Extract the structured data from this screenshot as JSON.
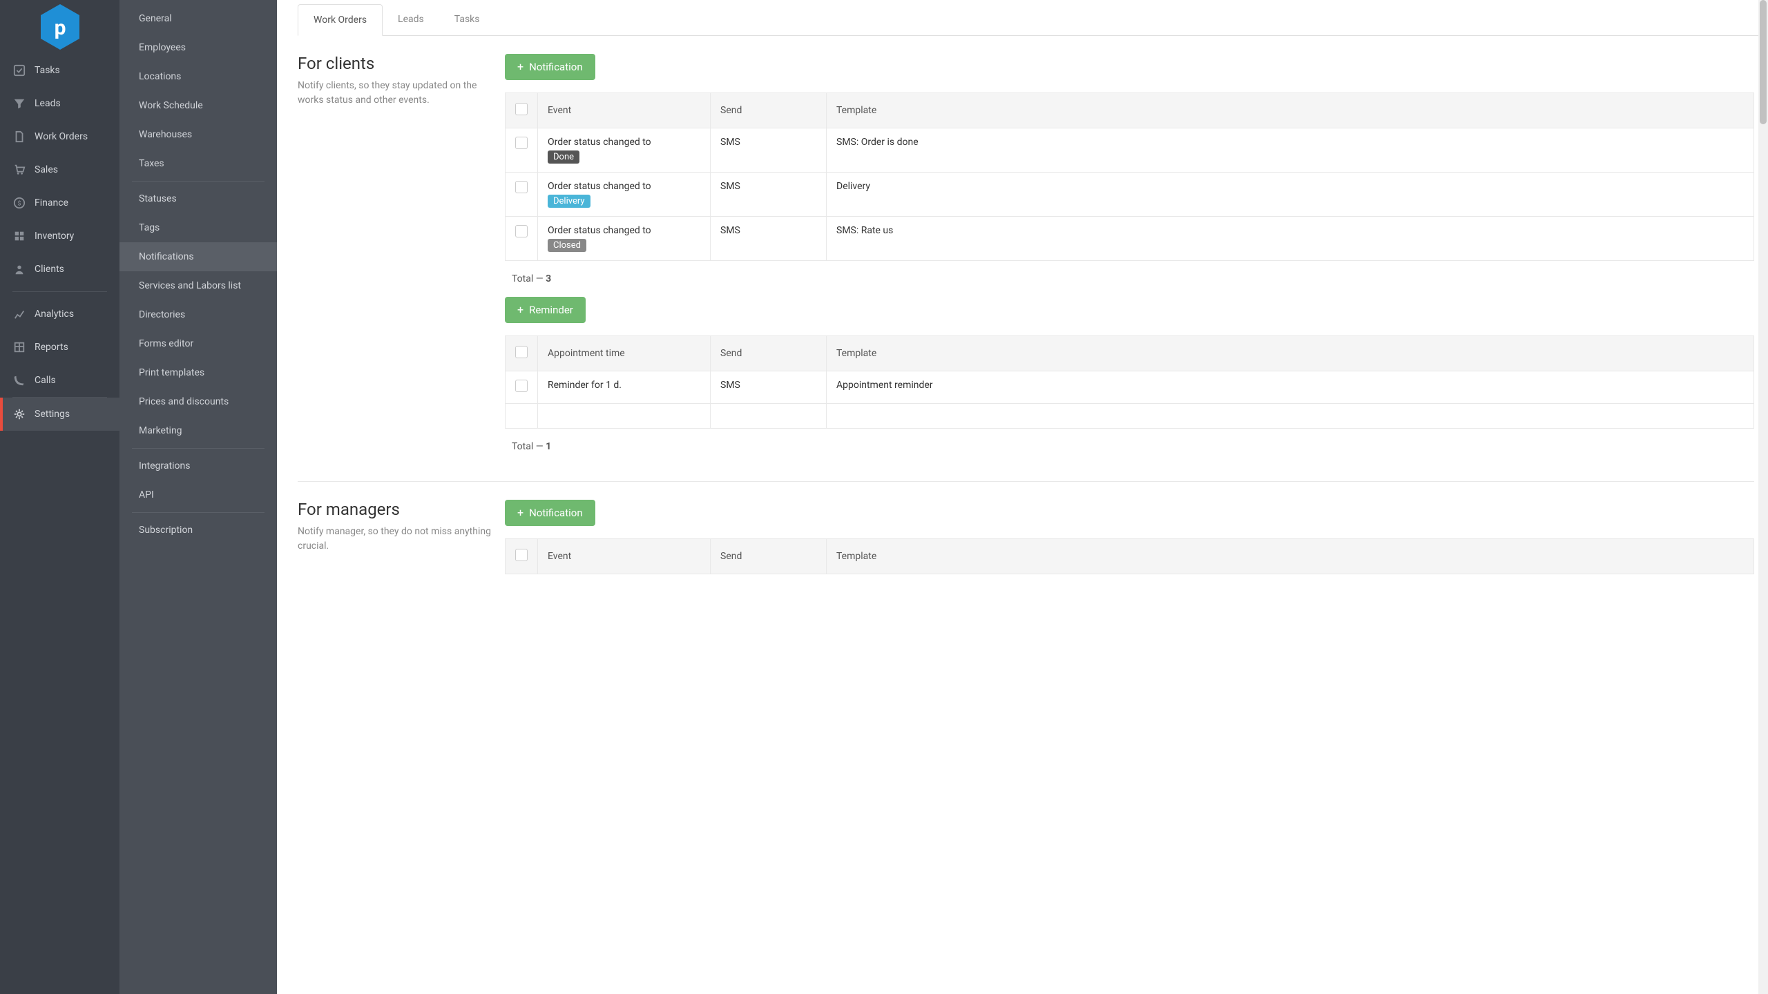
{
  "primaryNav": [
    {
      "label": "Tasks",
      "icon": "check"
    },
    {
      "label": "Leads",
      "icon": "funnel"
    },
    {
      "label": "Work Orders",
      "icon": "doc"
    },
    {
      "label": "Sales",
      "icon": "cart"
    },
    {
      "label": "Finance",
      "icon": "dollar"
    },
    {
      "label": "Inventory",
      "icon": "boxes"
    },
    {
      "label": "Clients",
      "icon": "person"
    },
    {
      "label": "Analytics",
      "icon": "chart"
    },
    {
      "label": "Reports",
      "icon": "grid"
    },
    {
      "label": "Calls",
      "icon": "phone"
    },
    {
      "label": "Settings",
      "icon": "gear"
    }
  ],
  "secondaryNav": {
    "group1": [
      "General",
      "Employees",
      "Locations",
      "Work Schedule",
      "Warehouses",
      "Taxes"
    ],
    "group2": [
      "Statuses",
      "Tags",
      "Notifications",
      "Services and Labors list",
      "Directories",
      "Forms editor",
      "Print templates",
      "Prices and discounts",
      "Marketing"
    ],
    "group3": [
      "Integrations",
      "API"
    ],
    "group4": [
      "Subscription"
    ],
    "active": "Notifications"
  },
  "tabs": [
    "Work Orders",
    "Leads",
    "Tasks"
  ],
  "activeTab": "Work Orders",
  "clients": {
    "title": "For clients",
    "desc": "Notify clients, so they stay updated on the works status and other events.",
    "addBtn": "Notification",
    "headers": {
      "event": "Event",
      "send": "Send",
      "template": "Template"
    },
    "rows": [
      {
        "event": "Order status changed to",
        "status": "Done",
        "statusClass": "status-done",
        "send": "SMS",
        "template": "SMS: Order is done"
      },
      {
        "event": "Order status changed to",
        "status": "Delivery",
        "statusClass": "status-delivery",
        "send": "SMS",
        "template": "Delivery"
      },
      {
        "event": "Order status changed to",
        "status": "Closed",
        "statusClass": "status-closed",
        "send": "SMS",
        "template": "SMS: Rate us"
      }
    ],
    "totalLabel": "Total — ",
    "totalValue": "3",
    "reminderBtn": "Reminder",
    "reminderHeaders": {
      "event": "Appointment time",
      "send": "Send",
      "template": "Template"
    },
    "reminderRows": [
      {
        "event": "Reminder for 1 d.",
        "send": "SMS",
        "template": "Appointment reminder"
      }
    ],
    "reminderTotalLabel": "Total — ",
    "reminderTotalValue": "1"
  },
  "managers": {
    "title": "For managers",
    "desc": "Notify manager, so they do not miss anything crucial.",
    "addBtn": "Notification",
    "headers": {
      "event": "Event",
      "send": "Send",
      "template": "Template"
    }
  }
}
